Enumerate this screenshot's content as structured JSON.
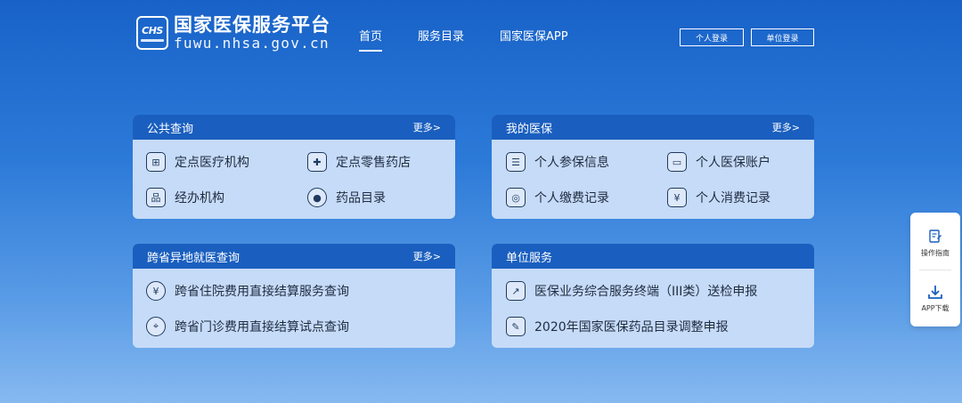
{
  "header": {
    "logo_mark": "CHS",
    "title": "国家医保服务平台",
    "url": "fuwu.nhsa.gov.cn",
    "nav": [
      {
        "label": "首页",
        "active": true
      },
      {
        "label": "服务目录",
        "active": false
      },
      {
        "label": "国家医保APP",
        "active": false
      }
    ],
    "login_personal": "个人登录",
    "login_unit": "单位登录"
  },
  "cards": [
    {
      "title": "公共查询",
      "more": "更多>",
      "items": [
        {
          "label": "定点医疗机构",
          "icon": "hospital-icon"
        },
        {
          "label": "定点零售药店",
          "icon": "pharmacy-icon"
        },
        {
          "label": "经办机构",
          "icon": "org-chart-icon"
        },
        {
          "label": "药品目录",
          "icon": "pill-icon"
        }
      ]
    },
    {
      "title": "我的医保",
      "more": "更多>",
      "items": [
        {
          "label": "个人参保信息",
          "icon": "insurance-doc-icon"
        },
        {
          "label": "个人医保账户",
          "icon": "wallet-icon"
        },
        {
          "label": "个人缴费记录",
          "icon": "payment-record-icon"
        },
        {
          "label": "个人消费记录",
          "icon": "yuan-receipt-icon"
        }
      ]
    },
    {
      "title": "跨省异地就医查询",
      "more": "更多>",
      "items": [
        {
          "label": "跨省住院费用直接结算服务查询",
          "icon": "yuan-coin-icon"
        },
        {
          "label": "跨省门诊费用直接结算试点查询",
          "icon": "location-pin-icon"
        }
      ]
    },
    {
      "title": "单位服务",
      "items": [
        {
          "label": "医保业务综合服务终端（III类）送检申报",
          "icon": "terminal-chart-icon"
        },
        {
          "label": "2020年国家医保药品目录调整申报",
          "icon": "document-edit-icon"
        }
      ]
    }
  ],
  "side_tools": [
    {
      "label": "操作指南",
      "icon": "guide-icon"
    },
    {
      "label": "APP下载",
      "icon": "download-icon"
    }
  ],
  "colors": {
    "brand": "#1a5fbf",
    "card_bg": "#c6dbf7",
    "text_dark": "#1e2c42"
  }
}
